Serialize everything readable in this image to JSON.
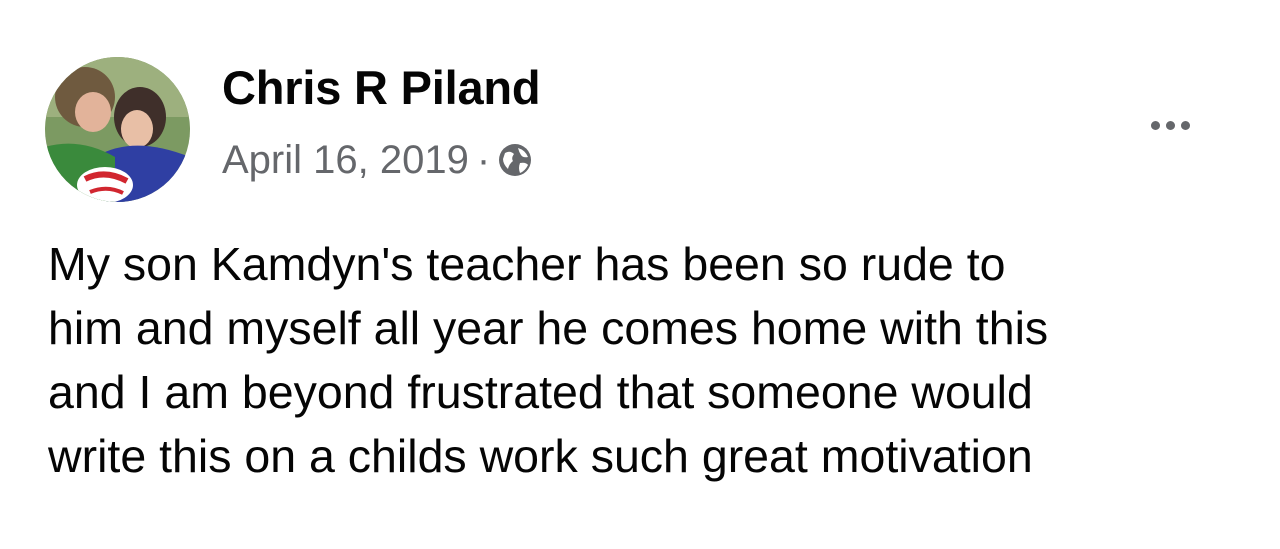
{
  "post": {
    "author": "Chris R Piland",
    "date": "April 16, 2019",
    "separator": "·",
    "audience_icon": "globe-icon",
    "more_icon": "more-options-icon",
    "text_lines": [
      "My son Kamdyn's teacher has been so rude to",
      "him and myself all year he comes home with this",
      "and I am beyond frustrated that someone would",
      "write this on a childs work such great motivation"
    ]
  },
  "colors": {
    "primary_text": "#050505",
    "secondary_text": "#65676b",
    "background": "#ffffff"
  }
}
